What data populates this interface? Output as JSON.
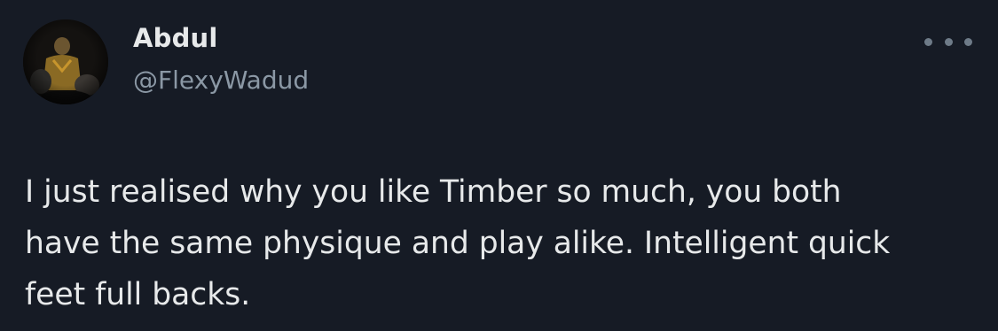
{
  "user": {
    "display_name": "Abdul",
    "handle": "@FlexyWadud",
    "avatar_icon": "profile-avatar"
  },
  "actions": {
    "more_icon": "more-horizontal-icon"
  },
  "tweet": {
    "text": "I just realised why you like Timber so much, you both\nhave the same physique and play alike. Intelligent quick\nfeet full backs."
  },
  "colors": {
    "background": "#161b25",
    "primary_text": "#e7e9ea",
    "secondary_text": "#8b98a5"
  }
}
